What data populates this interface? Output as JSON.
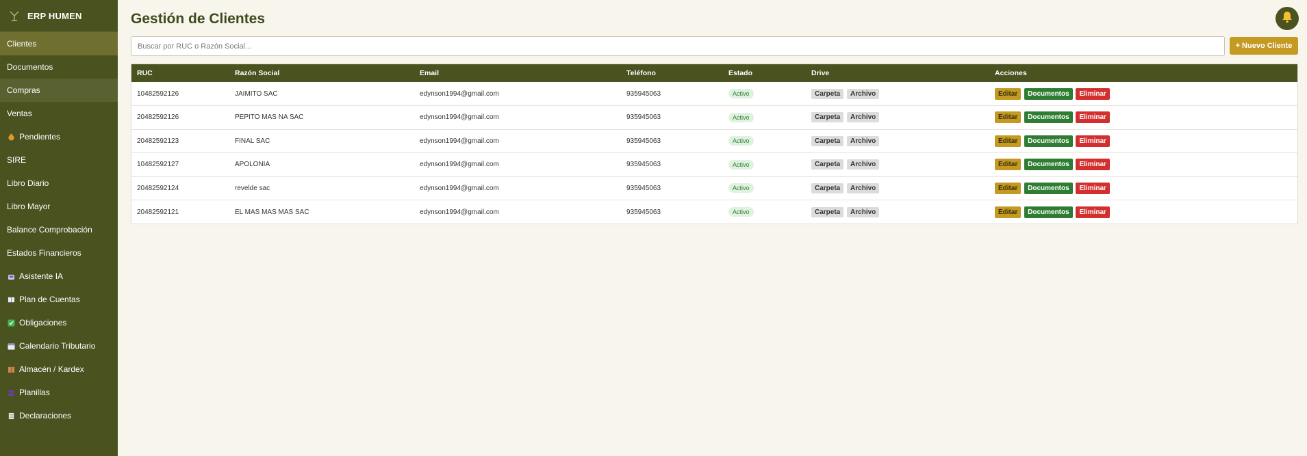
{
  "app": {
    "brand": "ERP HUMEN"
  },
  "sidebar": {
    "items": [
      {
        "label": "Clientes",
        "icon": "",
        "active": true
      },
      {
        "label": "Documentos",
        "icon": ""
      },
      {
        "label": "Compras",
        "icon": ""
      },
      {
        "label": "Ventas",
        "icon": ""
      },
      {
        "label": "Pendientes",
        "icon": "money-bag-icon"
      },
      {
        "label": "SIRE",
        "icon": ""
      },
      {
        "label": "Libro Diario",
        "icon": ""
      },
      {
        "label": "Libro Mayor",
        "icon": ""
      },
      {
        "label": "Balance Comprobación",
        "icon": ""
      },
      {
        "label": "Estados Financieros",
        "icon": ""
      },
      {
        "label": "Asistente IA",
        "icon": "robot-icon"
      },
      {
        "label": "Plan de Cuentas",
        "icon": "book-icon"
      },
      {
        "label": "Obligaciones",
        "icon": "check-box-icon"
      },
      {
        "label": "Calendario Tributario",
        "icon": "calendar-icon"
      },
      {
        "label": "Almacén / Kardex",
        "icon": "package-icon"
      },
      {
        "label": "Planillas",
        "icon": "people-icon"
      },
      {
        "label": "Declaraciones",
        "icon": "document-icon"
      }
    ]
  },
  "header": {
    "title": "Gestión de Clientes"
  },
  "search": {
    "placeholder": "Buscar por RUC o Razón Social..."
  },
  "toolbar": {
    "new_client_label": "+ Nuevo Cliente"
  },
  "table": {
    "columns": [
      "RUC",
      "Razón Social",
      "Email",
      "Teléfono",
      "Estado",
      "Drive",
      "Acciones"
    ],
    "drive_labels": {
      "folder": "Carpeta",
      "file": "Archivo"
    },
    "action_labels": {
      "edit": "Editar",
      "docs": "Documentos",
      "delete": "Eliminar"
    },
    "rows": [
      {
        "ruc": "10482592126",
        "razon": "JAIMITO SAC",
        "email": "edynson1994@gmail.com",
        "telefono": "935945063",
        "estado": "Activo"
      },
      {
        "ruc": "20482592126",
        "razon": "PEPITO MAS NA SAC",
        "email": "edynson1994@gmail.com",
        "telefono": "935945063",
        "estado": "Activo"
      },
      {
        "ruc": "20482592123",
        "razon": "FINAL SAC",
        "email": "edynson1994@gmail.com",
        "telefono": "935945063",
        "estado": "Activo"
      },
      {
        "ruc": "10482592127",
        "razon": "APOLONIA",
        "email": "edynson1994@gmail.com",
        "telefono": "935945063",
        "estado": "Activo"
      },
      {
        "ruc": "20482592124",
        "razon": "revelde sac",
        "email": "edynson1994@gmail.com",
        "telefono": "935945063",
        "estado": "Activo"
      },
      {
        "ruc": "20482592121",
        "razon": "EL MAS MAS MAS SAC",
        "email": "edynson1994@gmail.com",
        "telefono": "935945063",
        "estado": "Activo"
      }
    ]
  },
  "colors": {
    "sidebar": "#4a5220",
    "accent": "#c49a22",
    "success": "#2e7d32",
    "danger": "#d32f2f",
    "background": "#f8f5ec"
  }
}
